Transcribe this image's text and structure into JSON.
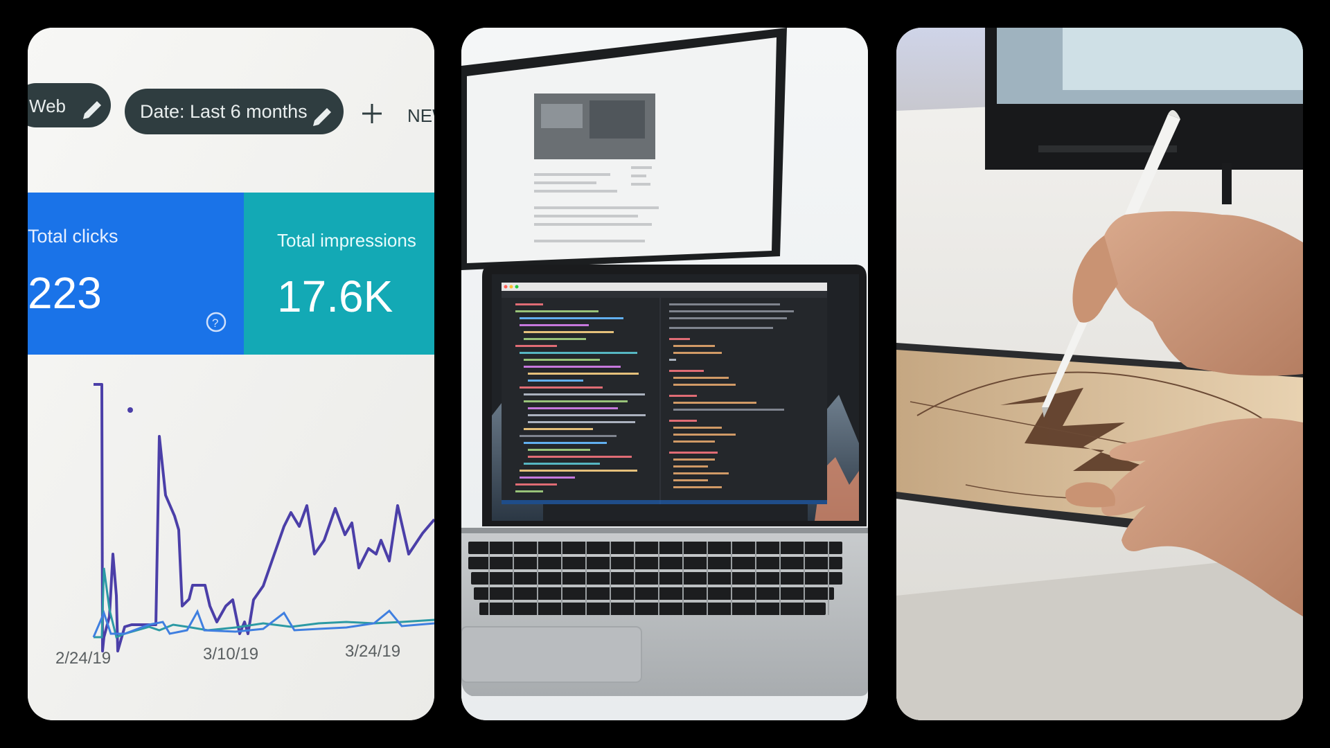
{
  "analytics": {
    "chip_web": "Web",
    "chip_date": "Date: Last 6 months",
    "chip_new": "NEW",
    "metric_clicks_label": "Total clicks",
    "metric_clicks_value": "223",
    "metric_impr_label": "Total impressions",
    "metric_impr_value": "17.6K",
    "x_ticks": [
      "2/24/19",
      "3/10/19",
      "3/24/19"
    ],
    "colors": {
      "clicks_blue": "#1a73e8",
      "impressions_teal": "#13a9b5",
      "line_purple": "#4b3fa8",
      "chip_dark": "#2f3d40"
    }
  },
  "photos": {
    "laptop": "laptop-code-photo",
    "tablet": "tablet-drawing-photo"
  }
}
